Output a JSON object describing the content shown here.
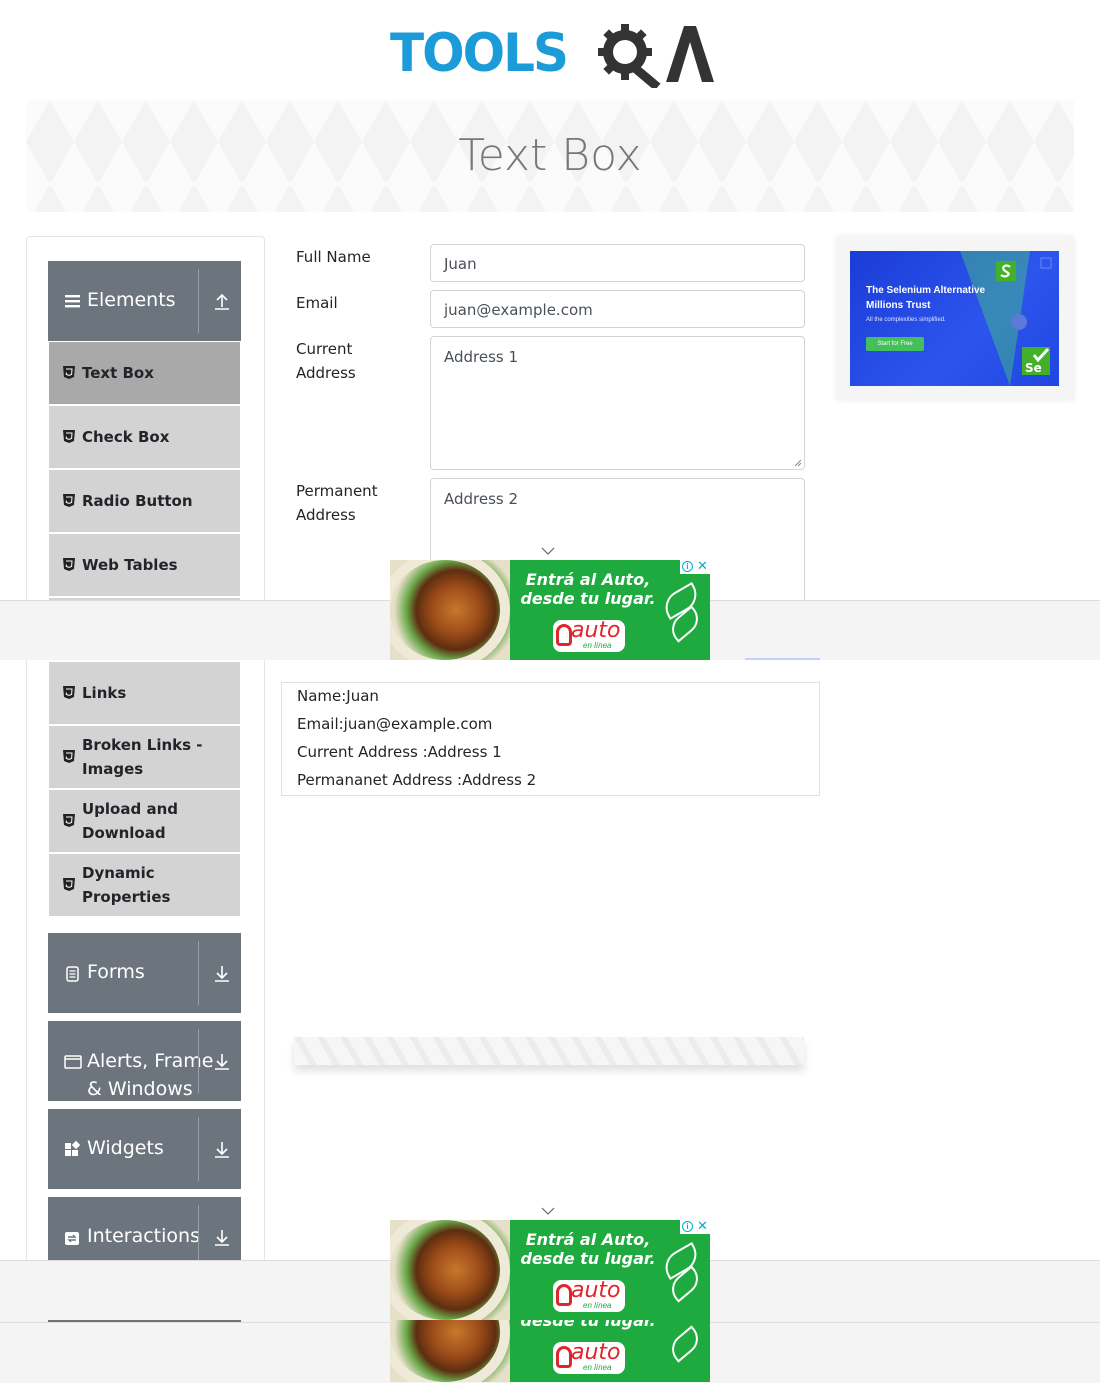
{
  "header": {
    "logo_text": "TOOLS",
    "logo_suffix": "QA",
    "page_title": "Text Box"
  },
  "sidebar": {
    "groups": [
      {
        "label": "Elements",
        "icon": "hamburger-icon",
        "state": "expanded"
      },
      {
        "label": "Forms",
        "icon": "document-icon",
        "state": "collapsed"
      },
      {
        "label": "Alerts, Frame & Windows",
        "label_line1": "Alerts, Frame",
        "label_line2": "& Windows",
        "icon": "window-icon",
        "state": "collapsed"
      },
      {
        "label": "Widgets",
        "icon": "widgets-icon",
        "state": "collapsed"
      },
      {
        "label": "Interactions",
        "icon": "interactions-icon",
        "state": "collapsed"
      }
    ],
    "items": [
      {
        "label": "Text Box",
        "active": true
      },
      {
        "label": "Check Box"
      },
      {
        "label": "Radio Button"
      },
      {
        "label": "Web Tables"
      },
      {
        "label": "Links"
      },
      {
        "label": "Broken Links - Images",
        "line1": "Broken Links -",
        "line2": "Images"
      },
      {
        "label": "Upload and Download",
        "line1": "Upload and",
        "line2": "Download"
      },
      {
        "label": "Dynamic Properties",
        "line1": "Dynamic",
        "line2": "Properties"
      }
    ]
  },
  "form": {
    "full_name": {
      "label": "Full Name",
      "value": "Juan"
    },
    "email": {
      "label": "Email",
      "value": "juan@example.com"
    },
    "current_address": {
      "label_line1": "Current",
      "label_line2": "Address",
      "value": "Address 1"
    },
    "permanent_address": {
      "label_line1": "Permanent",
      "label_line2": "Address",
      "value": "Address 2"
    }
  },
  "output": {
    "name": "Name:Juan",
    "email": "Email:juan@example.com",
    "current_address": "Current Address :Address 1",
    "permanent_address": "Permananet Address :Address 2"
  },
  "ads": {
    "right": {
      "title": "The Selenium Alternative Millions Trust",
      "subtitle": "All the complexities simplified.",
      "button": "Start for Free"
    },
    "food": {
      "headline_line1": "Entrá al Auto,",
      "headline_line2": "desde tu lugar.",
      "brand": "auto",
      "brand_sub": "en línea"
    }
  },
  "colors": {
    "logo_blue": "#1b9bd7",
    "sidebar_header": "#6c757d",
    "sidebar_item": "#d3d3d3",
    "sidebar_item_active": "#a9a9a9",
    "ad_green": "#1faa3f",
    "ad_blue": "#1b3cd6"
  }
}
